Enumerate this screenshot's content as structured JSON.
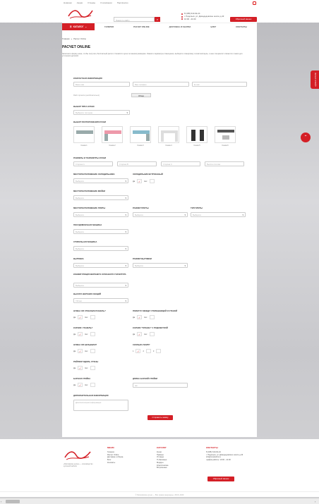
{
  "topbar": {
    "links": [
      "Новинки",
      "Акции",
      "Отзывы",
      "О компании",
      "Портфолио"
    ]
  },
  "header": {
    "search_placeholder": "Поиск по сайту",
    "phone": "8 (495) 610-92-24",
    "address": "г. Подольск, ул. Домодедовское шоссе д.43",
    "hours": "10:00 - 21:00",
    "callback_label": "Обратный звонок"
  },
  "nav": {
    "catalog_label": "КАТАЛОГ",
    "items": [
      "ГАЛЕРЕЯ",
      "РАСЧЕТ ONLINE",
      "ДОСТАВКА И СБОРКА",
      "БЛОГ",
      "КОНТАКТЫ"
    ]
  },
  "breadcrumb": {
    "home": "Главная",
    "sep": "»",
    "current": "Расчет Online"
  },
  "page_title": "РАСЧЕТ ONLINE",
  "intro": "Заполните форму ниже, чтобы получить бесплатный расчет стоимости кухни по вашим размерам. Укажите параметры помещения, выберите планировку и комплектацию, и наш специалист свяжется с вами для уточнения деталей.",
  "form": {
    "contact_label": "КОНТАКТНАЯ ИНФОРМАЦИЯ",
    "name_ph": "Ваше имя",
    "phone_ph": "Ваш телефон",
    "email_ph": "E-mail",
    "upload_note": "Файл проекта (необязательно)",
    "upload_btn": "Обзор",
    "type_label": "ВЫБОР ТИПА КУХНИ",
    "type_ph": "Выберите тип кухни",
    "layout_label": "ВЫБОР РАСПОЛОЖЕНИЯ КУХНИ",
    "layouts": [
      "Схема 1",
      "Схема 2",
      "Схема 3",
      "Схема 4",
      "Схема 5",
      "Схема 6"
    ],
    "sizes_label": "РАЗМЕРЫ И ПАРАМЕТРЫ КУХНИ",
    "size_a": "Сторона А",
    "size_b": "Сторона B",
    "size_c": "Сторона C",
    "ceiling": "Высота потолка",
    "fridge_label": "МЕСТОРАСПОЛОЖЕНИЕ ХОЛОДИЛЬНИКА",
    "fridge_builtin_label": "ХОЛОДИЛЬНИК ВСТРОЕННЫЙ",
    "yes": "Да",
    "no": "Нет",
    "select_ph": "Выберите",
    "sink_label": "МЕСТОРАСПОЛОЖЕНИЕ МОЙКИ",
    "stove_label": "МЕСТОРАСПОЛОЖЕНИЕ ПЛИТЫ",
    "stove_size_label": "РАЗМЕР ПЛИТЫ",
    "stove_type_label": "ТИП ПЛИТЫ",
    "dishwasher_label": "ПОСУДОМОЕЧНАЯ МАШИНА",
    "washer_label": "СТИРАЛЬНАЯ МАШИНА",
    "hood_label": "ВЫТЯЖКА",
    "hood_size_label": "РАЗМЕР ВЫТЯЖКИ",
    "config_label": "КОНФИГУРАЦИЯ ВЕРХНЕГО КУХОННОГО ГАРНИТУРА",
    "top_height_label": "ВЫСОТА ВЕРХНИХ СЕКЦИЙ",
    "top_height_val": "720 мм",
    "wall_panel_label": "НУЖНА ЛИ СТЕНОВАЯ ПАНЕЛЬ?",
    "plinth_label": "ПЛИНТУС МЕЖДУ СТОЛЕШНИЦЕЙ И СТЕНОЙ",
    "cornice_label": "КАРНИЗ / ПАНЕЛЬ?",
    "plank_label": "КАРНИЗ \"ПЛАНКА\" С ПОДСВЕТКОЙ",
    "pantry_label": "НУЖНА ЛИ БЕЛЬЕВАЯ?",
    "count_label": "СКОЛЬКО ЛАМП?",
    "count_vals": [
      "1",
      "2",
      "3"
    ],
    "rail_label": "РЕЙЛИНГ ВДОЛЬ СТЕНЫ",
    "bar_label": "БАРНАЯ СТОЙКА",
    "bar_len_label": "ДЛИНА БАРНОЙ СТОЙКИ",
    "bar_len_ph": "мм",
    "extra_label": "ДОПОЛНИТЕЛЬНАЯ ИНФОРМАЦИЯ",
    "extra_ph": "Дополнительная информация",
    "submit": "Отправить заявку"
  },
  "side_tab": "РАСЧЕТ ОНЛАЙН",
  "footer": {
    "desc": "«Московские кухни» — производство кухонной мебели",
    "menu_title": "МЕНЮ",
    "menu": [
      "Галерея",
      "Расчет Online",
      "Доставка и сборка",
      "Блог",
      "Контакты"
    ],
    "catalog_title": "КАТАЛОГ",
    "catalog": [
      "Кухни",
      "Прямые",
      "Угловые",
      "П-образные",
      "Модерн",
      "Классические",
      "Встроенные"
    ],
    "contacts_title": "КОНТАКТЫ",
    "contacts": [
      "8 (495) 610-92-24",
      "г. Подольск, ул. Домодедовское шоссе д.43",
      "info@moskuhni.ru",
      "график работы: 10:00 - 21:00"
    ],
    "callback_label": "Обратный звонок",
    "copyright": "© Московские кухни — Все права защищены. 2016–2020"
  },
  "colors": {
    "accent": "#d41f26"
  }
}
